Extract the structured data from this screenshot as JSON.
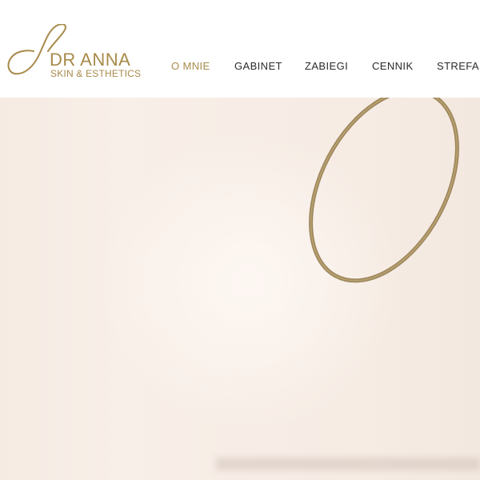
{
  "brand": {
    "title": "DR ANNA",
    "subtitle": "SKIN & ESTHETICS",
    "accent_color": "#a88a4a"
  },
  "nav": {
    "items": [
      {
        "label": "O MNIE",
        "active": true
      },
      {
        "label": "GABINET",
        "active": false
      },
      {
        "label": "ZABIEGI",
        "active": false
      },
      {
        "label": "CENNIK",
        "active": false
      },
      {
        "label": "STREFA I",
        "active": false
      }
    ]
  },
  "hero": {
    "background_color": "#f6ece4",
    "ring_color": "#8c7344"
  }
}
